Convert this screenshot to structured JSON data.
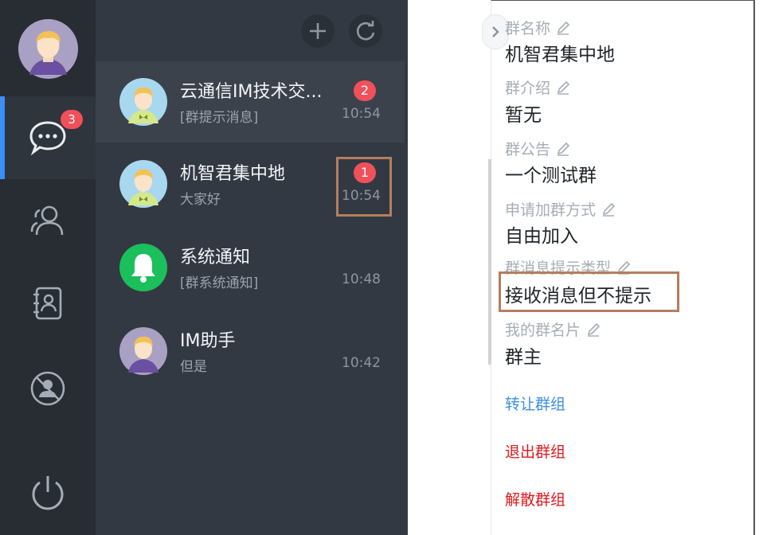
{
  "nav": {
    "badge_count": "3",
    "items": [
      "chat-icon",
      "contacts-icon",
      "address-book-icon",
      "blocked-user-icon",
      "power-icon"
    ]
  },
  "toolbar": {
    "add_icon": "plus-icon",
    "refresh_icon": "refresh-icon"
  },
  "conversations": [
    {
      "name": "云通信IM技术交...",
      "last_message": "[群提示消息]",
      "time": "10:54",
      "unread": "2",
      "avatar": "boy-green-shirt"
    },
    {
      "name": "机智君集中地",
      "last_message": "大家好",
      "time": "10:54",
      "unread": "1",
      "avatar": "boy-green-shirt"
    },
    {
      "name": "系统通知",
      "last_message": "[群系统通知]",
      "time": "10:48",
      "unread": "",
      "avatar": "bell-icon"
    },
    {
      "name": "IM助手",
      "last_message": "但是",
      "time": "10:42",
      "unread": "",
      "avatar": "boy-purple-shirt"
    }
  ],
  "group_info": {
    "fields": [
      {
        "label": "群名称",
        "value": "机智君集中地"
      },
      {
        "label": "群介绍",
        "value": "暂无"
      },
      {
        "label": "群公告",
        "value": "一个测试群"
      },
      {
        "label": "申请加群方式",
        "value": "自由加入"
      },
      {
        "label": "群消息提示类型",
        "value": "接收消息但不提示"
      },
      {
        "label": "我的群名片",
        "value": "群主"
      }
    ],
    "actions": {
      "transfer": "转让群组",
      "quit": "退出群组",
      "dismiss": "解散群组"
    }
  },
  "colors": {
    "rail_bg": "#282d34",
    "list_bg": "#323943",
    "accent": "#3b8ff6",
    "badge": "#f0505a",
    "highlight_box": "#b57e5e",
    "link_blue": "#3a8fe0",
    "danger_red": "#e0191e",
    "online_green": "#1bbf5b"
  }
}
